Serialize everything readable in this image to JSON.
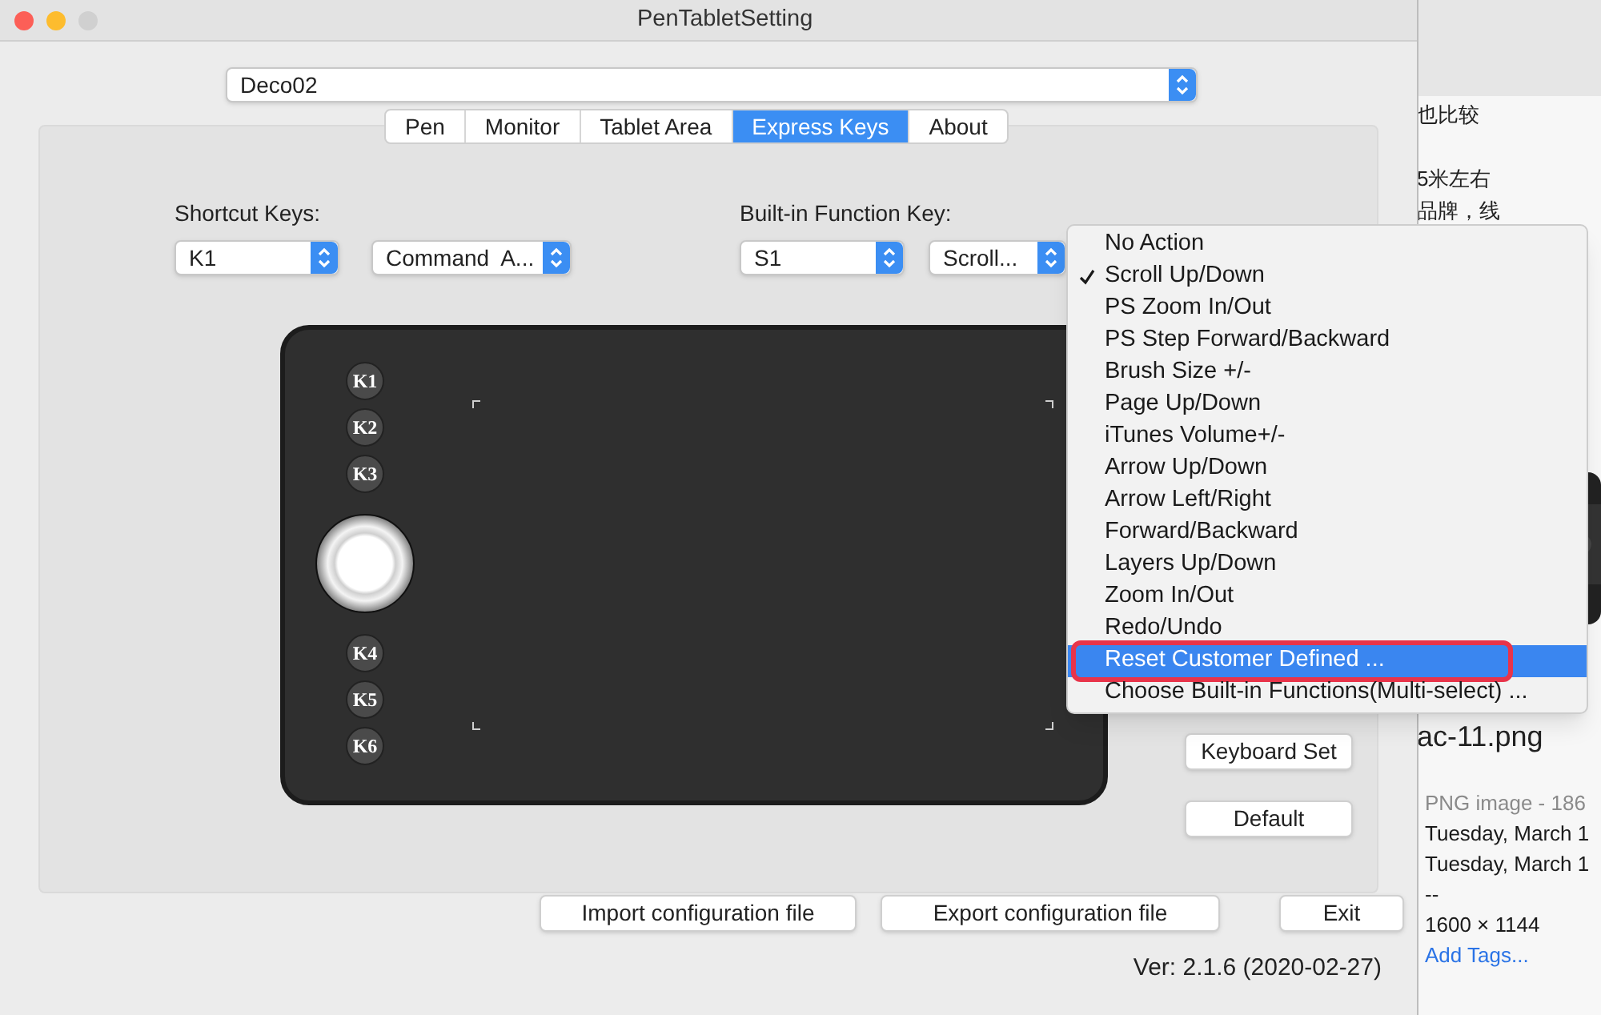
{
  "window": {
    "title": "PenTabletSetting"
  },
  "device_select": {
    "value": "Deco02"
  },
  "tabs": [
    {
      "label": "Pen",
      "selected": false
    },
    {
      "label": "Monitor",
      "selected": false
    },
    {
      "label": "Tablet Area",
      "selected": false
    },
    {
      "label": "Express Keys",
      "selected": true
    },
    {
      "label": "About",
      "selected": false
    }
  ],
  "shortcut_keys": {
    "label": "Shortcut Keys:",
    "key": "K1",
    "action": "Command  A..."
  },
  "builtin_function_key": {
    "label": "Built-in Function Key:",
    "key": "S1",
    "action": "Scroll..."
  },
  "tablet": {
    "controls": [
      {
        "kind": "key",
        "label": "K1"
      },
      {
        "kind": "key",
        "label": "K2"
      },
      {
        "kind": "key",
        "label": "K3"
      },
      {
        "kind": "dial"
      },
      {
        "kind": "key",
        "label": "K4"
      },
      {
        "kind": "key",
        "label": "K5"
      },
      {
        "kind": "key",
        "label": "K6"
      }
    ]
  },
  "side_buttons": [
    "Keyboard Set",
    "Default"
  ],
  "bottom_buttons": [
    "Import configuration file",
    "Export configuration file",
    "Exit"
  ],
  "version": "Ver: 2.1.6 (2020-02-27)",
  "dropdown_menu": {
    "items": [
      {
        "label": "No Action",
        "checked": false,
        "selected": false
      },
      {
        "label": "Scroll Up/Down",
        "checked": true,
        "selected": false
      },
      {
        "label": "PS Zoom In/Out",
        "checked": false,
        "selected": false
      },
      {
        "label": "PS Step Forward/Backward",
        "checked": false,
        "selected": false
      },
      {
        "label": "Brush Size +/-",
        "checked": false,
        "selected": false
      },
      {
        "label": "Page Up/Down",
        "checked": false,
        "selected": false
      },
      {
        "label": "iTunes Volume+/-",
        "checked": false,
        "selected": false
      },
      {
        "label": "Arrow Up/Down",
        "checked": false,
        "selected": false
      },
      {
        "label": "Arrow Left/Right",
        "checked": false,
        "selected": false
      },
      {
        "label": "Forward/Backward",
        "checked": false,
        "selected": false
      },
      {
        "label": "Layers Up/Down",
        "checked": false,
        "selected": false
      },
      {
        "label": "Zoom In/Out",
        "checked": false,
        "selected": false
      },
      {
        "label": "Redo/Undo",
        "checked": false,
        "selected": false
      },
      {
        "label": "Reset Customer Defined ...",
        "checked": false,
        "selected": true
      },
      {
        "label": "Choose Built-in Functions(Multi-select) ...",
        "checked": false,
        "selected": false
      }
    ]
  },
  "background_window": {
    "text_lines": [
      "也比较",
      "5米左右",
      "品牌，线"
    ],
    "file_name": "ac-11.png",
    "info_lines": [
      {
        "kind": "muted",
        "text": "PNG image - 186"
      },
      {
        "kind": "plain",
        "text": "Tuesday, March 1"
      },
      {
        "kind": "plain",
        "text": "Tuesday, March 1"
      },
      {
        "kind": "plain",
        "text": "--"
      },
      {
        "kind": "plain",
        "text": "1600 × 1144"
      },
      {
        "kind": "link",
        "text": "Add Tags..."
      }
    ]
  }
}
